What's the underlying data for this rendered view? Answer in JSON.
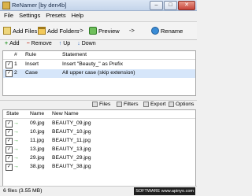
{
  "window": {
    "title": "ReNamer  [by den4b]",
    "minimize": "–",
    "maximize": "□",
    "close": "✕"
  },
  "menu": [
    "File",
    "Settings",
    "Presets",
    "Help"
  ],
  "toolbar": {
    "add_files": "Add Files",
    "add_folders": "Add Folders",
    "arrow1": "->",
    "preview": "Preview",
    "arrow2": "->",
    "rename": "Rename"
  },
  "rules_toolbar": {
    "add": "Add",
    "remove": "Remove",
    "up": "Up",
    "down": "Down"
  },
  "rules": {
    "columns": [
      "#",
      "Rule",
      "Statement"
    ],
    "rows": [
      {
        "checked": true,
        "num": "1",
        "rule": "Insert",
        "statement": "Insert \"Beauty_\" as Prefix"
      },
      {
        "checked": true,
        "num": "2",
        "rule": "Case",
        "statement": "All upper case (skip extension)"
      }
    ]
  },
  "files_toolbar": {
    "files": "Files",
    "filters": "Filters",
    "export": "Export",
    "options": "Options"
  },
  "files": {
    "columns": [
      "State",
      "Name",
      "New Name"
    ],
    "rows": [
      {
        "checked": true,
        "name": "09.jpg",
        "new_name": "BEAUTY_09.jpg"
      },
      {
        "checked": true,
        "name": "10.jpg",
        "new_name": "BEAUTY_10.jpg"
      },
      {
        "checked": true,
        "name": "11.jpg",
        "new_name": "BEAUTY_11.jpg"
      },
      {
        "checked": true,
        "name": "13.jpg",
        "new_name": "BEAUTY_13.jpg"
      },
      {
        "checked": true,
        "name": "29.jpg",
        "new_name": "BEAUTY_29.jpg"
      },
      {
        "checked": true,
        "name": "38.jpg",
        "new_name": "BEAUTY_38.jpg"
      }
    ]
  },
  "status": {
    "text": "6 files (3.55 MB)",
    "watermark": "SOFTWARE www.apinyo.com"
  },
  "colors": {
    "accent": "#3a8cd6",
    "green": "#2f9b2f",
    "red": "#c0301f",
    "selected_row": "#d6e6fa"
  }
}
